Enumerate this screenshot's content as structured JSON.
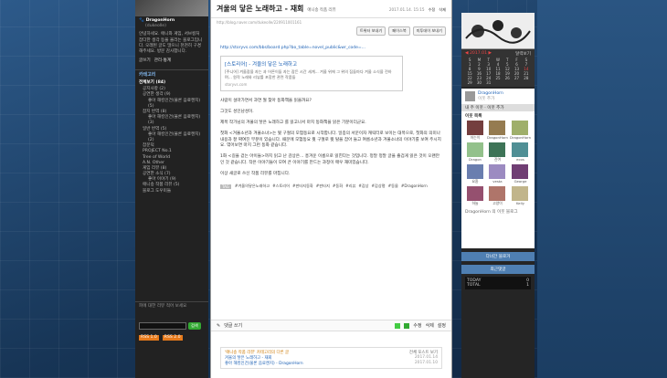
{
  "profile": {
    "name": "DragonHorn",
    "handle": "(dukeolle)",
    "bio": "안녕하세요. 애니와 게임, 서브컬처 잡다한 생각 등을 올리는 블로그입니다. 오래된 글도 많으니 천천히 구경해주세요. 방문 감사합니다.",
    "links": [
      "글쓰기",
      "관리",
      "방명록"
    ]
  },
  "left_links": {
    "manage": "관리자 메뉴",
    "write": "글쓰기",
    "admin": "관리·통계"
  },
  "category": {
    "title": "카테고리",
    "total": "전체보기 (84)",
    "items": [
      "공지사항 (2)",
      "공연한 생각 (9)",
      "좋아 해킹인건(물론 음료캔지) (5)",
      "잡지 번역 (8)",
      "좋아 해킹인건(물론 음료캔지) (3)",
      "일반 번역 (5)",
      "좋아 해킹인건(물론 음료캔지) (2)",
      "잡문덕",
      "PROJECT No.1",
      "Tree of World",
      "A.N. Other",
      "게임 리뷰 (8)",
      "공연한 소식 (7)",
      "좋아 이야기 (9)",
      "애니송 작품 리뷰 (5)",
      "블로그 도우미들"
    ]
  },
  "left_footer": {
    "note": "피에 대한 리뷰 적어 보세요",
    "search_btn": "검색",
    "rss1": "RSS 1.0",
    "rss2": "RSS 2.0"
  },
  "post": {
    "title": "겨울의 닿은 노래하고 - 재회",
    "category_link": "애니송 작품 리뷰",
    "date": "2017.01.14. 15:15",
    "actions": [
      "수정",
      "삭제"
    ],
    "url_display": "http://blog.naver.com/dukeolle/220911001161",
    "share": [
      "트위터 보내기",
      "페이스북",
      "미투데이 보내기"
    ],
    "link1": "http://storyvs.com/bbs/board.php?bo_table=novel_public&wr_code=..."
  },
  "quote_box": {
    "title": "[스토리어] - 겨울의 닿은 노래하고",
    "body": "[주니어] 겨울잠을 자는 과 어른이들 자는 잠든 시간 세계... 겨울 위에 그 위의 집들마다 겨울 소식을 전하며... 원작 노래와 리뷰를 포함한 관련 작품들",
    "domain": "storyvs.com"
  },
  "paragraphs": [
    "사람이 설마가면서 과연 뭘 찾아 동화책을 읽을까요?",
    "그것도 성인남성이.",
    "제목 작가님의 겨울의 닿은 노래하고 를 읽고나서 마치 동화책을 읽은 기분이더군요.",
    "첫화 <겨울소년과 겨울소녀>는 뭣 구절의 모험동요로 시작합니다. 일종의 서문이자 캐릭터로 보이는 대목으로, 첫화의 의미나 내용과 잘 짜여진 부분이 있습니다. 때문에 모험동요 뭣 구절로 뭣 탈을 잡아 들고 여름소년과 겨울소녀의 이야기를 보여 주시지요. 엮어보면 마치 그런 동화 같습니다.",
    "1화 <길을 걷는 아이들>까지 읽고 난 감상은... 흥겨운 이름으로 읽힌다는 것입니다. 정말 정말 글을 즐겁게 읽은 것이 오랜만인 것 같습니다. 작은 이야기들이 모여 큰 이야기를 만드는 과정이 매우 재미있습니다.",
    "이상 새글로 쓰신 작품 리뷰를 마칩니다."
  ],
  "tags": [
    "#겨울의닿은노래하고",
    "#스토리어",
    "#판타지동화",
    "#판타지",
    "#동화",
    "#리뷰",
    "#감상",
    "#감상평",
    "#동물",
    "#DragonHorn"
  ],
  "comment_bar": {
    "label": "댓글 쓰기",
    "actions": [
      "수정",
      "삭제",
      "설정"
    ]
  },
  "related": {
    "header": "'애니송 작품 리뷰' 카테고리의 다른 글",
    "more": "전체 포스트 보기",
    "items": [
      {
        "t": "겨울의 닿은 노래하고 - 재회",
        "d": "2017.01.14"
      },
      {
        "t": "좋아 해킹인건(물론 음료캔지) - DragonHorn",
        "d": "2017.01.10"
      }
    ]
  },
  "calendar": {
    "month": "◀ 2017.01 ▶",
    "days": [
      "S",
      "M",
      "T",
      "W",
      "T",
      "F",
      "S"
    ],
    "label": "달력보기"
  },
  "sidebar_profile": {
    "name": "DragonHorn",
    "sub": "이웃 추가",
    "bio": "내 주 이웃 · 이웃 추가"
  },
  "neighbors": {
    "title": "이웃 목록",
    "names": [
      "아는이",
      "DragonHorn",
      "DragonHorn",
      "Dragon",
      "진여",
      "ecos",
      "요환",
      "vesta",
      "George",
      "하늘",
      "고양이",
      "Kelly"
    ],
    "footer": "DragonHorn 의 이웃 블로그"
  },
  "widgets": {
    "w1": "다녀간 블로거",
    "w2": "최근댓글",
    "counter_labels": [
      "TODAY",
      "TOTAL"
    ],
    "counter_values": [
      "0",
      "1"
    ]
  },
  "colors": {
    "accent": "#3b86c9",
    "link": "#1a5fb4",
    "side_bg": "#222222"
  }
}
